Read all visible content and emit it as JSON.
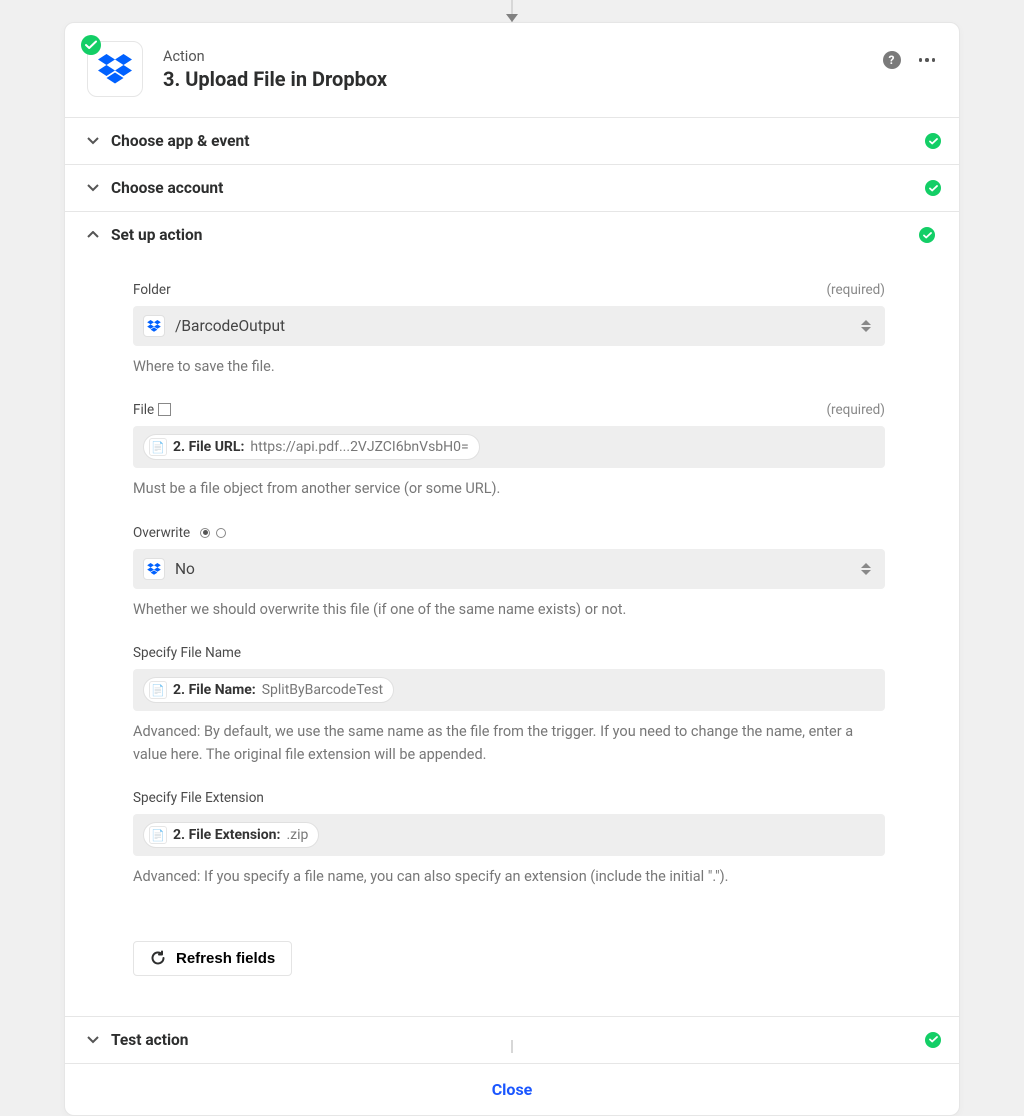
{
  "header": {
    "kicker": "Action",
    "title": "3. Upload File in Dropbox"
  },
  "sections": {
    "choose_app": "Choose app & event",
    "choose_account": "Choose account",
    "setup": "Set up action",
    "test": "Test action"
  },
  "fields": {
    "folder": {
      "label": "Folder",
      "required": "(required)",
      "value": "/BarcodeOutput",
      "hint": "Where to save the file."
    },
    "file": {
      "label": "File",
      "required": "(required)",
      "pill_label": "2. File URL:",
      "pill_value": "https://api.pdf...2VJZCI6bnVsbH0=",
      "hint": "Must be a file object from another service (or some URL)."
    },
    "overwrite": {
      "label": "Overwrite",
      "value": "No",
      "hint": "Whether we should overwrite this file (if one of the same name exists) or not."
    },
    "filename": {
      "label": "Specify File Name",
      "pill_label": "2. File Name:",
      "pill_value": "SplitByBarcodeTest",
      "hint": "Advanced: By default, we use the same name as the file from the trigger. If you need to change the name, enter a value here. The original file extension will be appended."
    },
    "extension": {
      "label": "Specify File Extension",
      "pill_label": "2. File Extension:",
      "pill_value": ".zip",
      "hint": "Advanced: If you specify a file name, you can also specify an extension (include the initial \".\")."
    }
  },
  "buttons": {
    "refresh": "Refresh fields",
    "close": "Close"
  }
}
